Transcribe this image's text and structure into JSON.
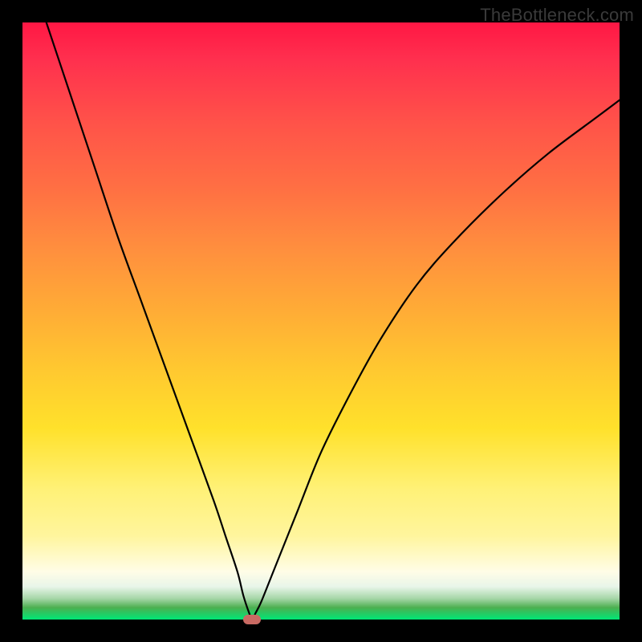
{
  "watermark": "TheBottleneck.com",
  "chart_data": {
    "type": "line",
    "title": "",
    "xlabel": "",
    "ylabel": "",
    "xlim": [
      0,
      100
    ],
    "ylim": [
      0,
      100
    ],
    "grid": false,
    "legend": false,
    "background": "rainbow-vertical-gradient",
    "series": [
      {
        "name": "bottleneck-curve",
        "color": "#000000",
        "x": [
          4,
          8,
          12,
          16,
          20,
          24,
          28,
          32,
          34,
          36,
          37,
          38,
          38.5,
          39,
          40,
          42,
          46,
          50,
          55,
          60,
          66,
          72,
          80,
          88,
          96,
          100
        ],
        "y": [
          100,
          88,
          76,
          64,
          53,
          42,
          31,
          20,
          14,
          8,
          4,
          1,
          0,
          1,
          3,
          8,
          18,
          28,
          38,
          47,
          56,
          63,
          71,
          78,
          84,
          87
        ]
      }
    ],
    "marker": {
      "x": 38.5,
      "y": 0,
      "color": "#c96a63",
      "shape": "rounded-rect"
    }
  },
  "colors": {
    "frame": "#000000",
    "gradient_top": "#ff1744",
    "gradient_mid": "#ffe12b",
    "gradient_bottom": "#00e676",
    "curve": "#000000",
    "marker": "#c96a63"
  }
}
